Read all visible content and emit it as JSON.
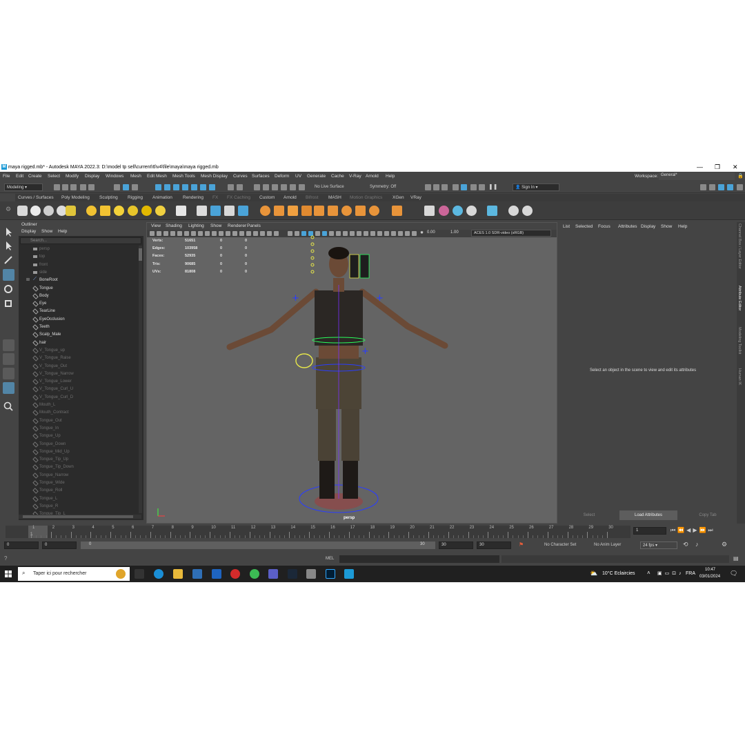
{
  "window": {
    "title": "maya rigged.mb* - Autodesk MAYA 2022.3: D:\\model tp sell\\current\\6\\v4\\file\\maya\\maya rigged.mb",
    "logo": "M"
  },
  "menu": [
    "File",
    "Edit",
    "Create",
    "Select",
    "Modify",
    "Display",
    "Windows",
    "Mesh",
    "Edit Mesh",
    "Mesh Tools",
    "Mesh Display",
    "Curves",
    "Surfaces",
    "Deform",
    "UV",
    "Generate",
    "Cache",
    "V-Ray",
    "Arnold",
    "Help"
  ],
  "workspace": {
    "label": "Workspace:",
    "value": "General*"
  },
  "status_line": {
    "mode": "Modeling",
    "live_surface": "No Live Surface",
    "symmetry": "Symmetry: Off",
    "sign_in": "Sign In"
  },
  "shelf_tabs": [
    "Curves / Surfaces",
    "Poly Modeling",
    "Sculpting",
    "Rigging",
    "Animation",
    "Rendering",
    "FX",
    "FX Caching",
    "Custom",
    "Arnold",
    "Bifrost",
    "MASH",
    "Motion Graphics",
    "XGen",
    "VRay"
  ],
  "outliner": {
    "title": "Outliner",
    "menu": [
      "Display",
      "Show",
      "Help"
    ],
    "search_placeholder": "Search...",
    "items": [
      "persp",
      "top",
      "front",
      "side",
      "BoneRoot",
      "Tongue",
      "Body",
      "Eye",
      "TearLine",
      "EyeOcclusion",
      "Teeth",
      "Scalp_Male",
      "hair",
      "V_Tongue_up",
      "V_Tongue_Raise",
      "V_Tongue_Out",
      "V_Tongue_Narrow",
      "V_Tongue_Lower",
      "V_Tongue_Curl_U",
      "V_Tongue_Curl_D",
      "Mouth_L",
      "Mouth_Contract",
      "Tongue_Out",
      "Tongue_In",
      "Tongue_Up",
      "Tongue_Down",
      "Tongue_Mid_Up",
      "Tongue_Tip_Up",
      "Tongue_Tip_Down",
      "Tongue_Narrow",
      "Tongue_Wide",
      "Tongue_Roll",
      "Tongue_L",
      "Tongue_R",
      "Tongue_Tip_L"
    ]
  },
  "viewport": {
    "menu": [
      "View",
      "Shading",
      "Lighting",
      "Show",
      "Renderer",
      "Panels"
    ],
    "exposure": "0.00",
    "gamma": "1.00",
    "color_space": "ACES 1.0 SDR-video (sRGB)",
    "camera": "persp",
    "hud": [
      {
        "label": "Verts:",
        "v1": "51651",
        "v2": "0",
        "v3": "0"
      },
      {
        "label": "Edges:",
        "v1": "103958",
        "v2": "0",
        "v3": "0"
      },
      {
        "label": "Faces:",
        "v1": "52935",
        "v2": "0",
        "v3": "0"
      },
      {
        "label": "Tris:",
        "v1": "90685",
        "v2": "0",
        "v3": "0"
      },
      {
        "label": "UVs:",
        "v1": "81808",
        "v2": "0",
        "v3": "0"
      }
    ]
  },
  "attribute_editor": {
    "menu": [
      "List",
      "Selected",
      "Focus",
      "Attributes",
      "Display",
      "Show",
      "Help"
    ],
    "message": "Select an object in the scene to view and edit its attributes",
    "buttons": [
      "Select",
      "Load Attributes",
      "Copy Tab"
    ],
    "side_tabs": [
      "Channel Box / Layer Editor",
      "Attribute Editor",
      "Modeling Toolkit",
      "Human IK"
    ]
  },
  "timeline": {
    "ticks": [
      "1",
      "2",
      "3",
      "4",
      "5",
      "6",
      "7",
      "8",
      "9",
      "10",
      "11",
      "12",
      "13",
      "14",
      "15",
      "16",
      "17",
      "18",
      "19",
      "20",
      "21",
      "22",
      "23",
      "24",
      "25",
      "26",
      "27",
      "28",
      "29",
      "30"
    ],
    "current_frame": "1",
    "playhead": "1"
  },
  "range": {
    "start": "0",
    "anim_start": "0",
    "slider_start": "0",
    "slider_end": "30",
    "end": "30",
    "anim_end": "30",
    "character_set": "No Character Set",
    "anim_layer": "No Anim Layer",
    "fps": "24 fps"
  },
  "command_line": {
    "lang": "MEL"
  },
  "taskbar": {
    "search_placeholder": "Taper ici pour rechercher",
    "weather": "10°C  Eclaircies",
    "lang": "FRA",
    "time": "10:47",
    "date": "03/01/2024"
  }
}
